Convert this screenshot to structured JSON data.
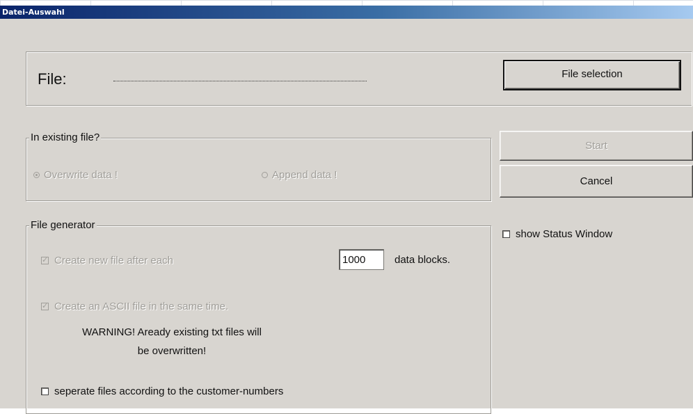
{
  "window": {
    "title": "Datei-Auswahl"
  },
  "file_panel": {
    "label": "File:",
    "path_value": "",
    "file_selection_button": "File selection"
  },
  "buttons": {
    "start": "Start",
    "cancel": "Cancel"
  },
  "existing_group": {
    "title": "In existing file?",
    "overwrite": "Overwrite data !",
    "append": "Append data !"
  },
  "generator_group": {
    "title": "File generator",
    "create_new_label": "Create new file after each",
    "blocks_value": "1000",
    "blocks_suffix": "data blocks.",
    "ascii_label": "Create an ASCII file in the same time.",
    "warning_line1": "WARNING! Aready existing txt files will",
    "warning_line2": "be overwritten!",
    "separate_label": "seperate files according to the customer-numbers"
  },
  "status_window_label": "show Status Window",
  "colors": {
    "titlebar_start": "#0a246a",
    "titlebar_end": "#a6caf0",
    "face": "#d8d5d0"
  }
}
